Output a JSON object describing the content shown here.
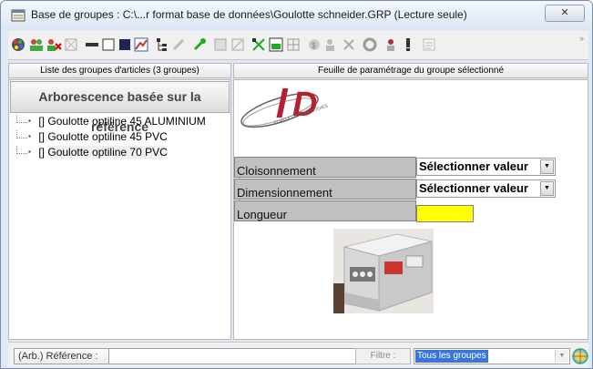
{
  "window": {
    "title": "Base de groupes : C:\\...r format base de données\\Goulotte schneider.GRP (Lecture seule)",
    "close_label": "✕"
  },
  "toolbar": {
    "icons": [
      "palette-icon",
      "group-icon",
      "group-delete-icon",
      "grid-icon",
      "minus-icon",
      "window-icon",
      "blue-square-icon",
      "chart-icon",
      "tree-icon",
      "tool-icon",
      "green-tool-icon",
      "disabled-icon",
      "disabled-chart-icon",
      "green-tree-icon",
      "green-table-icon",
      "grid2-icon",
      "money-icon",
      "people-icon",
      "delete-icon",
      "gear-icon",
      "user-icon",
      "exclamation-icon",
      "disabled-export-icon"
    ],
    "overflow_label": "»"
  },
  "left_panel": {
    "header": "Liste des groupes d'articles (3 groupes)",
    "arbo_label": "Arborescence basée sur la référence",
    "items": [
      {
        "prefix": "[]",
        "label": "Goulotte optiline 45 ALUMINIUM"
      },
      {
        "prefix": "[]",
        "label": "Goulotte optiline 45 PVC"
      },
      {
        "prefix": "[]",
        "label": "Goulotte optiline 70 PVC"
      }
    ]
  },
  "right_panel": {
    "header": "Feuille de paramétrage du groupe sélectionné",
    "logo_text": "D",
    "logo_subtext": "EURO ID TECHNOLOGIES",
    "rows": [
      {
        "label": "Cloisonnement",
        "value": "Sélectionner valeur"
      },
      {
        "label": "Dimensionnement",
        "value": "Sélectionner valeur"
      },
      {
        "label": "Longueur",
        "value": ""
      }
    ],
    "highlight_color": "#ffff00"
  },
  "statusbar": {
    "ref_label": "(Arb.) Référence :",
    "ref_value": "",
    "filter_label": "Filtre :",
    "filter_value": "Tous les groupes"
  }
}
